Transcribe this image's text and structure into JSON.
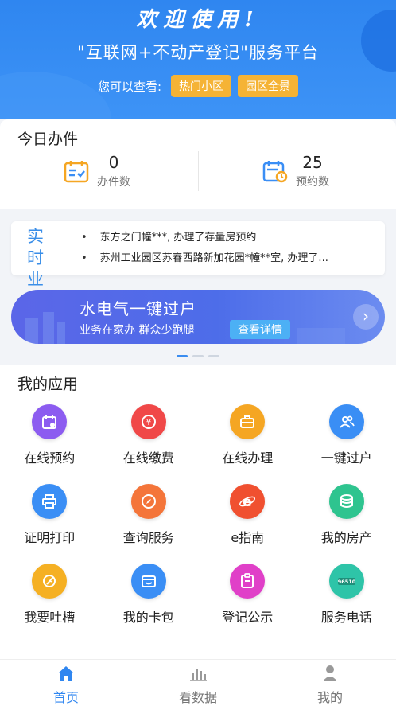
{
  "header": {
    "welcome": "欢迎使用!",
    "platform_title": "\"互联网+不动产登记\"服务平台",
    "view_label": "您可以查看:",
    "buttons": [
      "热门小区",
      "园区全景"
    ]
  },
  "today": {
    "title": "今日办件",
    "stats": [
      {
        "value": "0",
        "label": "办件数",
        "icon": "calendar-check-icon"
      },
      {
        "value": "25",
        "label": "预约数",
        "icon": "calendar-clock-icon"
      }
    ]
  },
  "realtime": {
    "title_line1": "实时",
    "title_line2": "业务",
    "items": [
      "东方之门幢***, 办理了存量房预约",
      "苏州工业园区苏春西路新加花园*幢**室, 办理了..."
    ]
  },
  "banner": {
    "title": "水电气一键过户",
    "subtitle": "业务在家办 群众少跑腿",
    "button": "查看详情"
  },
  "apps": {
    "title": "我的应用",
    "items": [
      {
        "label": "在线预约",
        "icon": "calendar-icon",
        "color": "#8c5cf0"
      },
      {
        "label": "在线缴费",
        "icon": "yen-icon",
        "color": "#f04848"
      },
      {
        "label": "在线办理",
        "icon": "briefcase-icon",
        "color": "#f5a623"
      },
      {
        "label": "一键过户",
        "icon": "users-icon",
        "color": "#3a8ef5"
      },
      {
        "label": "证明打印",
        "icon": "printer-icon",
        "color": "#3a8ef5"
      },
      {
        "label": "查询服务",
        "icon": "compass-icon",
        "color": "#f4753a"
      },
      {
        "label": "e指南",
        "icon": "ie-icon",
        "color": "#f05030"
      },
      {
        "label": "我的房产",
        "icon": "coins-icon",
        "color": "#2ec48f"
      },
      {
        "label": "我要吐槽",
        "icon": "feather-icon",
        "color": "#f5b023"
      },
      {
        "label": "我的卡包",
        "icon": "wallet-icon",
        "color": "#3a8ef5"
      },
      {
        "label": "登记公示",
        "icon": "clipboard-icon",
        "color": "#e040c8"
      },
      {
        "label": "服务电话",
        "icon": "phone-badge-icon",
        "color": "#2ec4a8",
        "badge_text": "96510"
      }
    ]
  },
  "tabbar": {
    "items": [
      {
        "label": "首页",
        "icon": "home-icon",
        "active": true
      },
      {
        "label": "看数据",
        "icon": "bar-chart-icon",
        "active": false
      },
      {
        "label": "我的",
        "icon": "person-icon",
        "active": false
      }
    ]
  },
  "colors": {
    "primary": "#2f86f0",
    "accent": "#f5b335",
    "realtime_title": "#3a8ee8"
  }
}
